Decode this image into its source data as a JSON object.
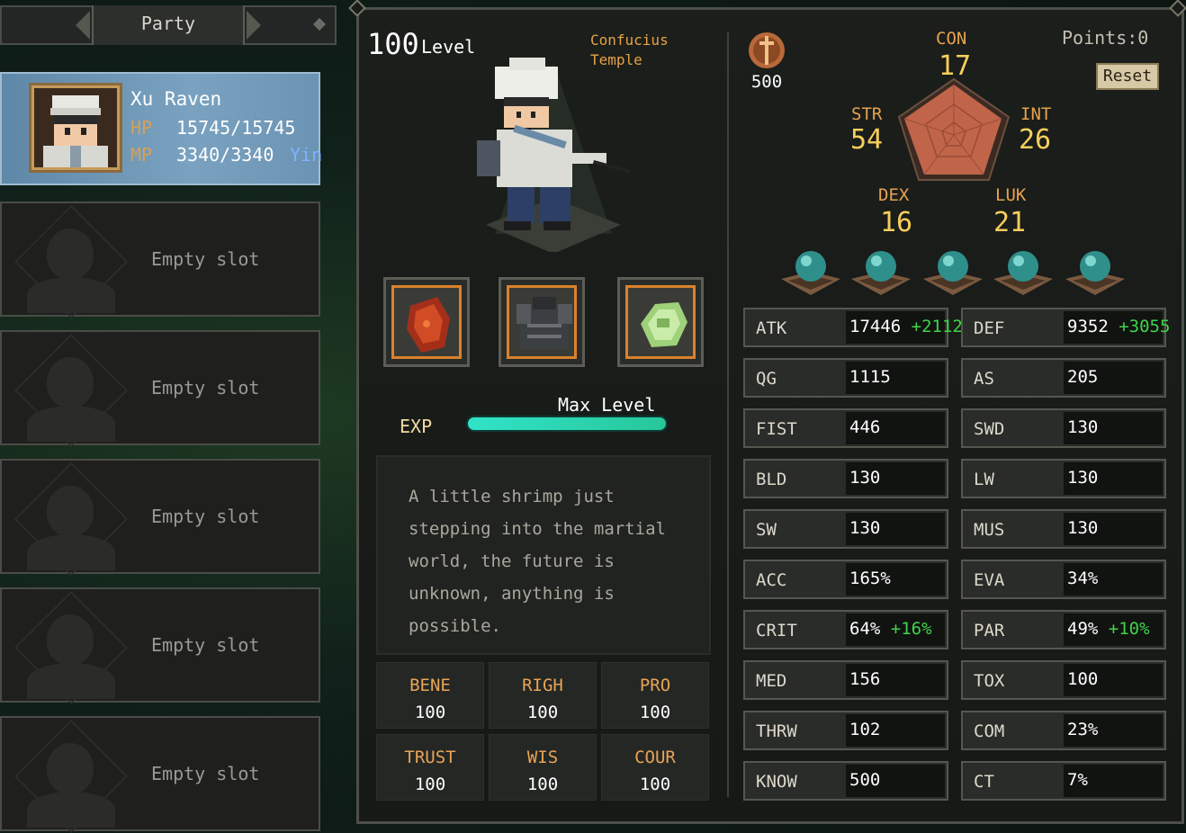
{
  "party": {
    "title": "Party",
    "member": {
      "name": "Xu Raven",
      "hp_label": "HP",
      "hp": "15745/15745",
      "mp_label": "MP",
      "mp": "3340/3340",
      "affinity": "Yin"
    },
    "empty_slot_label": "Empty slot",
    "empty_slots": [
      "Empty slot",
      "Empty slot",
      "Empty slot",
      "Empty slot",
      "Empty slot"
    ]
  },
  "character": {
    "level": "100",
    "level_label": "Level",
    "location": "Confucius Temple",
    "exp_label": "EXP",
    "exp_status": "Max Level",
    "exp_progress": 1.0,
    "description": "A little shrimp just stepping into the martial world, the future is unknown, anything is possible.",
    "equipment": [
      "fist-gauntlet-icon",
      "armor-icon",
      "jade-accessory-icon"
    ]
  },
  "virtues": [
    {
      "key": "BENE",
      "value": "100"
    },
    {
      "key": "RIGH",
      "value": "100"
    },
    {
      "key": "PRO",
      "value": "100"
    },
    {
      "key": "TRUST",
      "value": "100"
    },
    {
      "key": "WIS",
      "value": "100"
    },
    {
      "key": "COUR",
      "value": "100"
    }
  ],
  "attributes": {
    "currency": "500",
    "points_label": "Points:",
    "points": "0",
    "reset_label": "Reset",
    "CON": "17",
    "STR": "54",
    "INT": "26",
    "DEX": "16",
    "LUK": "21",
    "orb_count": 5
  },
  "stats": [
    {
      "key": "ATK",
      "value": "17446",
      "bonus": "+2112"
    },
    {
      "key": "DEF",
      "value": "9352",
      "bonus": "+3055"
    },
    {
      "key": "QG",
      "value": "1115",
      "bonus": ""
    },
    {
      "key": "AS",
      "value": "205",
      "bonus": ""
    },
    {
      "key": "FIST",
      "value": "446",
      "bonus": ""
    },
    {
      "key": "SWD",
      "value": "130",
      "bonus": ""
    },
    {
      "key": "BLD",
      "value": "130",
      "bonus": ""
    },
    {
      "key": "LW",
      "value": "130",
      "bonus": ""
    },
    {
      "key": "SW",
      "value": "130",
      "bonus": ""
    },
    {
      "key": "MUS",
      "value": "130",
      "bonus": ""
    },
    {
      "key": "ACC",
      "value": "165%",
      "bonus": ""
    },
    {
      "key": "EVA",
      "value": "34%",
      "bonus": ""
    },
    {
      "key": "CRIT",
      "value": "64%",
      "bonus": "+16%"
    },
    {
      "key": "PAR",
      "value": "49%",
      "bonus": "+10%"
    },
    {
      "key": "MED",
      "value": "156",
      "bonus": ""
    },
    {
      "key": "TOX",
      "value": "100",
      "bonus": ""
    },
    {
      "key": "THRW",
      "value": "102",
      "bonus": ""
    },
    {
      "key": "COM",
      "value": "23%",
      "bonus": ""
    },
    {
      "key": "KNOW",
      "value": "500",
      "bonus": ""
    },
    {
      "key": "CT",
      "value": "7%",
      "bonus": ""
    }
  ],
  "colors": {
    "accent_orange": "#e7a24f",
    "bonus_green": "#3fd44a",
    "exp_teal": "#31e3c9",
    "selected_blue": "#6b93b3"
  }
}
